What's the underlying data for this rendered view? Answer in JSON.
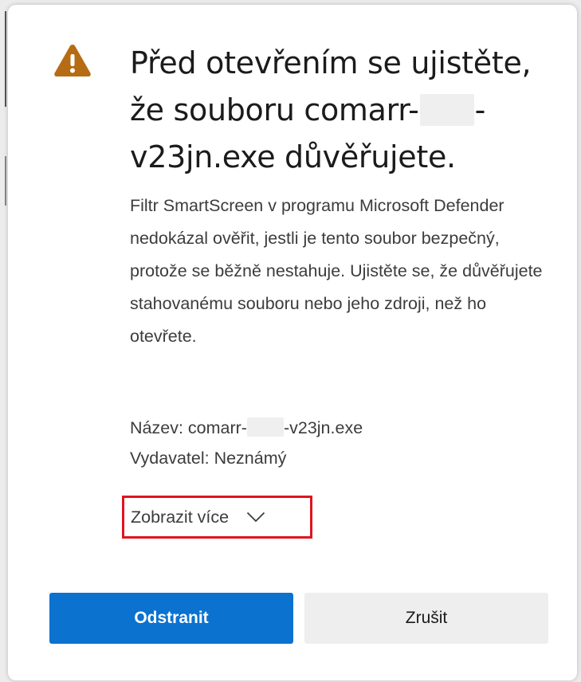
{
  "dialog": {
    "title_part1": "Před otevřením se ujistěte, že souboru comarr-",
    "title_part2": "-v23jn.exe důvěřujete.",
    "description": "Filtr SmartScreen v programu Microsoft Defender nedokázal ověřit, jestli je tento soubor bezpečný, protože se běžně nestahuje. Ujistěte se, že důvěřujete stahovanému souboru nebo jeho zdroji, než ho otevřete.",
    "name_label": "Název: comarr-",
    "name_suffix": "-v23jn.exe",
    "publisher": "Vydavatel: Neznámý",
    "show_more_label": "Zobrazit více",
    "primary_button": "Odstranit",
    "secondary_button": "Zrušit"
  },
  "icons": {
    "warning": "warning-icon",
    "chevron": "chevron-down-icon"
  },
  "colors": {
    "warning_icon": "#b56c14",
    "primary_button": "#0b72cf",
    "secondary_button": "#eeeeee",
    "highlight_border": "#e0141e"
  }
}
